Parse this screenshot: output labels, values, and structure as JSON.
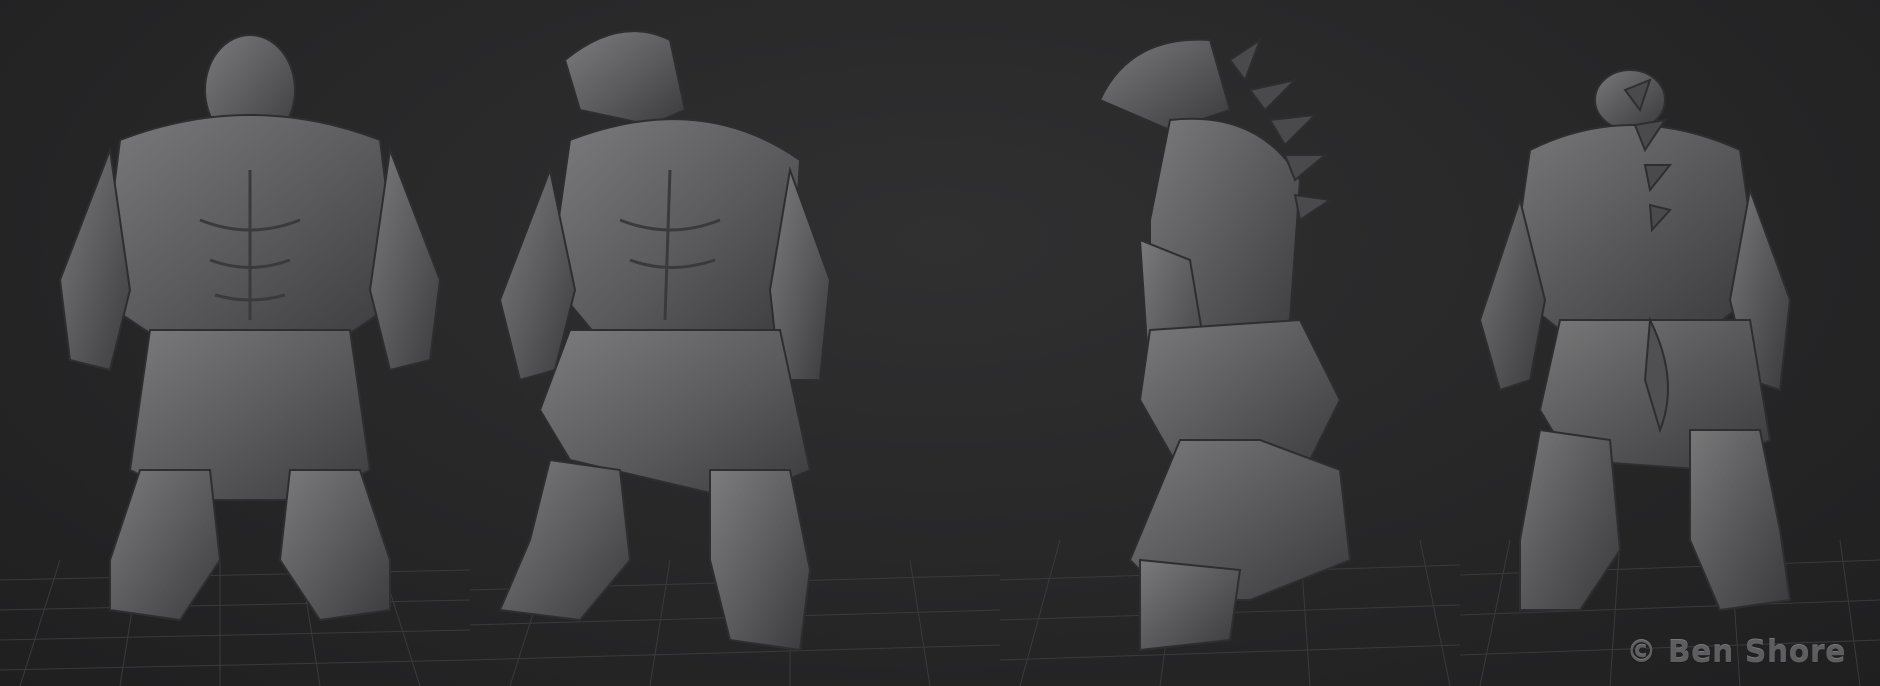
{
  "scene": {
    "subject": "lizard-creature-sculpt",
    "views": [
      "front",
      "three-quarter",
      "side",
      "back"
    ],
    "colors": {
      "background": "#262627",
      "grid": "#3a3a3c",
      "clay": "#5c5c5e",
      "clay_dark": "#3c3c3e",
      "clay_light": "#7a7a7c"
    }
  },
  "watermark": {
    "text": "© Ben Shore"
  }
}
